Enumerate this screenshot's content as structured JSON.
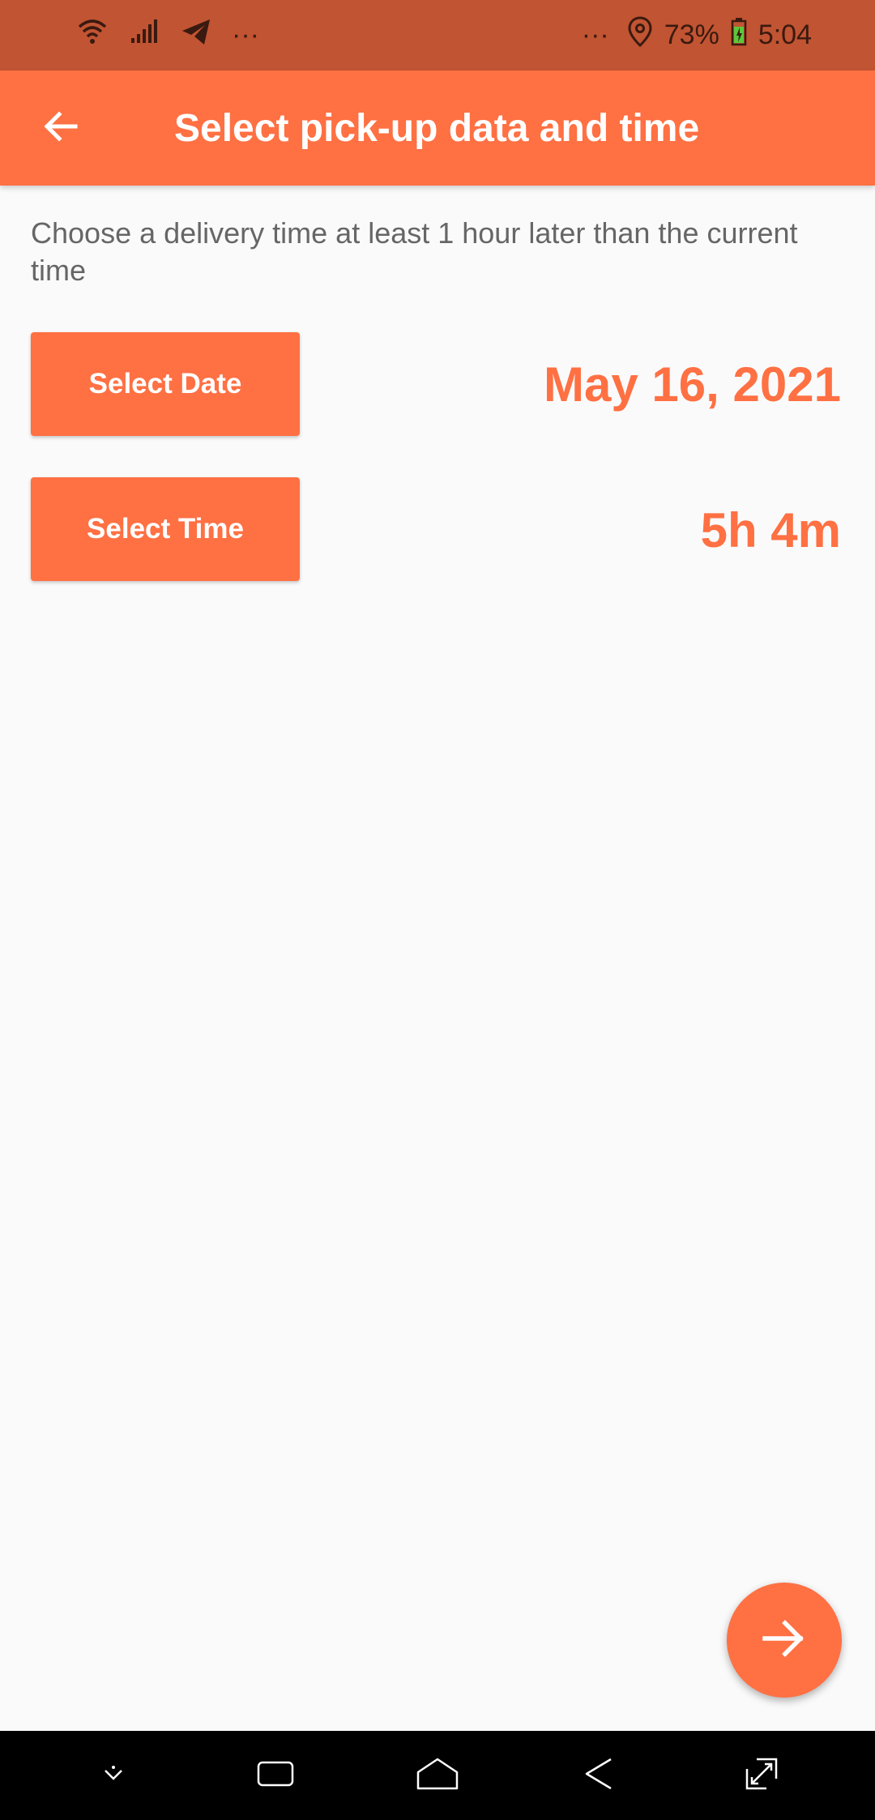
{
  "status_bar": {
    "left_icons": [
      "wifi-icon",
      "signal-icon",
      "telegram-icon"
    ],
    "left_more": "···",
    "right_more": "···",
    "battery_percent": "73%",
    "time": "5:04"
  },
  "app_bar": {
    "title": "Select pick-up data and time",
    "back_icon": "arrow-left-icon"
  },
  "content": {
    "instruction": "Choose a delivery time at least 1 hour later than the current time",
    "date_button_label": "Select Date",
    "date_value": "May 16, 2021",
    "time_button_label": "Select Time",
    "time_value": "5h 4m"
  },
  "fab": {
    "icon": "arrow-right-icon"
  },
  "nav_bar": {
    "icons": [
      "hide-keyboard-icon",
      "recent-apps-icon",
      "home-icon",
      "back-icon",
      "screen-rotate-icon"
    ]
  },
  "colors": {
    "accent": "#ff7043",
    "status_bar": "#c15432",
    "background": "#fafafa",
    "instruction_text": "#666666"
  }
}
